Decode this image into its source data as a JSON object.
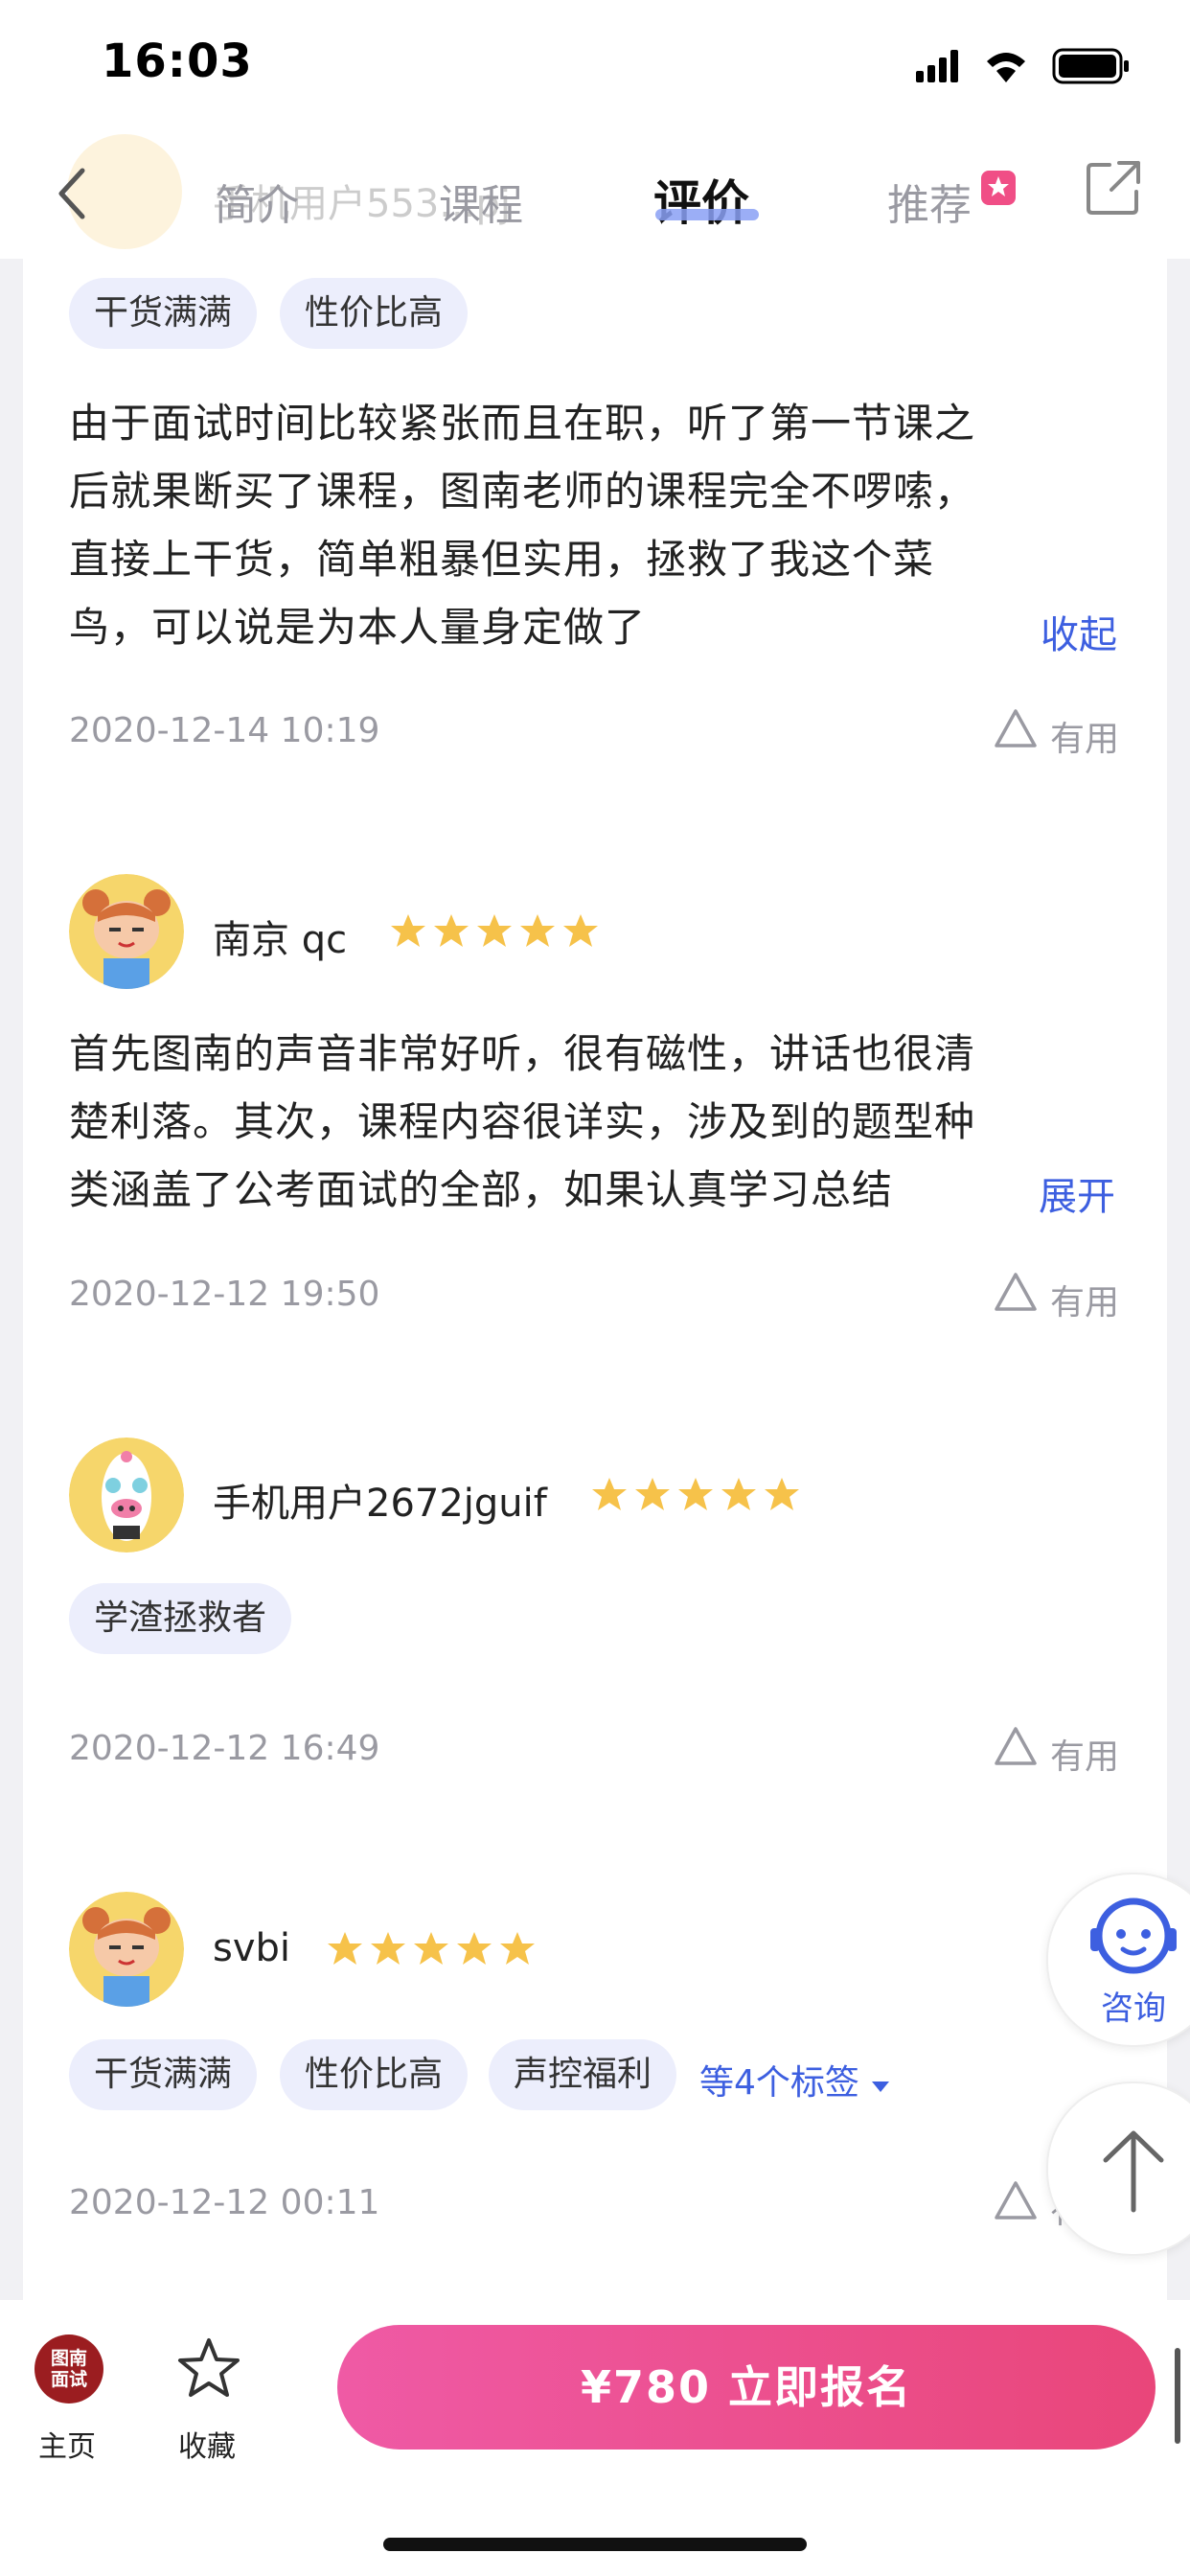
{
  "status_bar": {
    "time": "16:03"
  },
  "nav": {
    "tabs": [
      {
        "label": "简介"
      },
      {
        "label": "课程"
      },
      {
        "label": "评价",
        "active": true
      },
      {
        "label": "推荐"
      }
    ],
    "ghost_user": "手机用户553...pj"
  },
  "reviews": [
    {
      "tags": [
        "干货满满",
        "性价比高"
      ],
      "text": "由于面试时间比较紧张而且在职，听了第一节课之\n后就果断买了课程，图南老师的课程完全不啰嗦，\n直接上干货，简单粗暴但实用，拯救了我这个菜\n鸟，可以说是为本人量身定做了",
      "toggle": "收起",
      "date": "2020-12-14 10:19",
      "useful": "有用"
    },
    {
      "user": "南京 qc",
      "stars": 5,
      "text": "首先图南的声音非常好听，很有磁性，讲话也很清\n楚利落。其次，课程内容很详实，涉及到的题型种\n类涵盖了公考面试的全部，如果认真学习总结",
      "toggle": "展开",
      "date": "2020-12-12 19:50",
      "useful": "有用"
    },
    {
      "user": "手机用户2672jguif",
      "stars": 5,
      "tags": [
        "学渣拯救者"
      ],
      "date": "2020-12-12 16:49",
      "useful": "有用"
    },
    {
      "user": "svbi",
      "stars": 5,
      "tags": [
        "干货满满",
        "性价比高",
        "声控福利"
      ],
      "more_tags": "等4个标签",
      "date": "2020-12-12 00:11",
      "useful": "有用"
    }
  ],
  "float": {
    "consult_label": "咨询"
  },
  "bottom": {
    "home_logo_line1": "图南",
    "home_logo_line2": "面试",
    "home_label": "主页",
    "fav_label": "收藏",
    "enroll_label": "¥780  立即报名"
  },
  "colors": {
    "accent": "#3d5fe0",
    "star": "#f6c24a",
    "enroll_start": "#ef5aa5",
    "enroll_end": "#e9467a"
  }
}
